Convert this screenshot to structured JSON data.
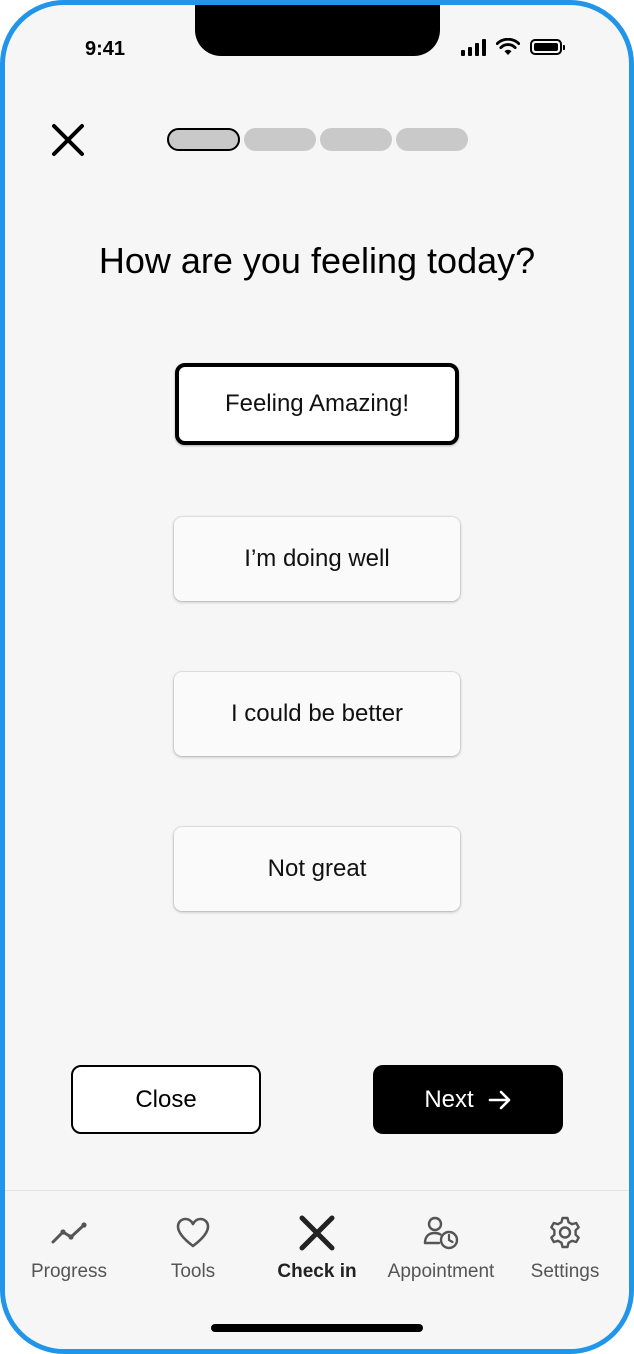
{
  "status_bar": {
    "time": "9:41"
  },
  "header": {
    "close_icon": "close-icon",
    "progress_steps": 4,
    "current_step": 1
  },
  "question": "How are you feeling today?",
  "options": [
    {
      "label": "Feeling Amazing!",
      "selected": true
    },
    {
      "label": "I’m doing well",
      "selected": false
    },
    {
      "label": "I could be better",
      "selected": false
    },
    {
      "label": "Not great",
      "selected": false
    }
  ],
  "actions": {
    "close_label": "Close",
    "next_label": "Next"
  },
  "tabbar": {
    "items": [
      {
        "label": "Progress",
        "icon": "trend-line-icon",
        "active": false
      },
      {
        "label": "Tools",
        "icon": "heart-icon",
        "active": false
      },
      {
        "label": "Check in",
        "icon": "x-icon",
        "active": true
      },
      {
        "label": "Appointment",
        "icon": "user-clock-icon",
        "active": false
      },
      {
        "label": "Settings",
        "icon": "gear-icon",
        "active": false
      }
    ]
  },
  "colors": {
    "frame": "#2195ea",
    "background": "#f6f6f6",
    "primary": "#000000",
    "progress_inactive": "#c9c9c9"
  }
}
